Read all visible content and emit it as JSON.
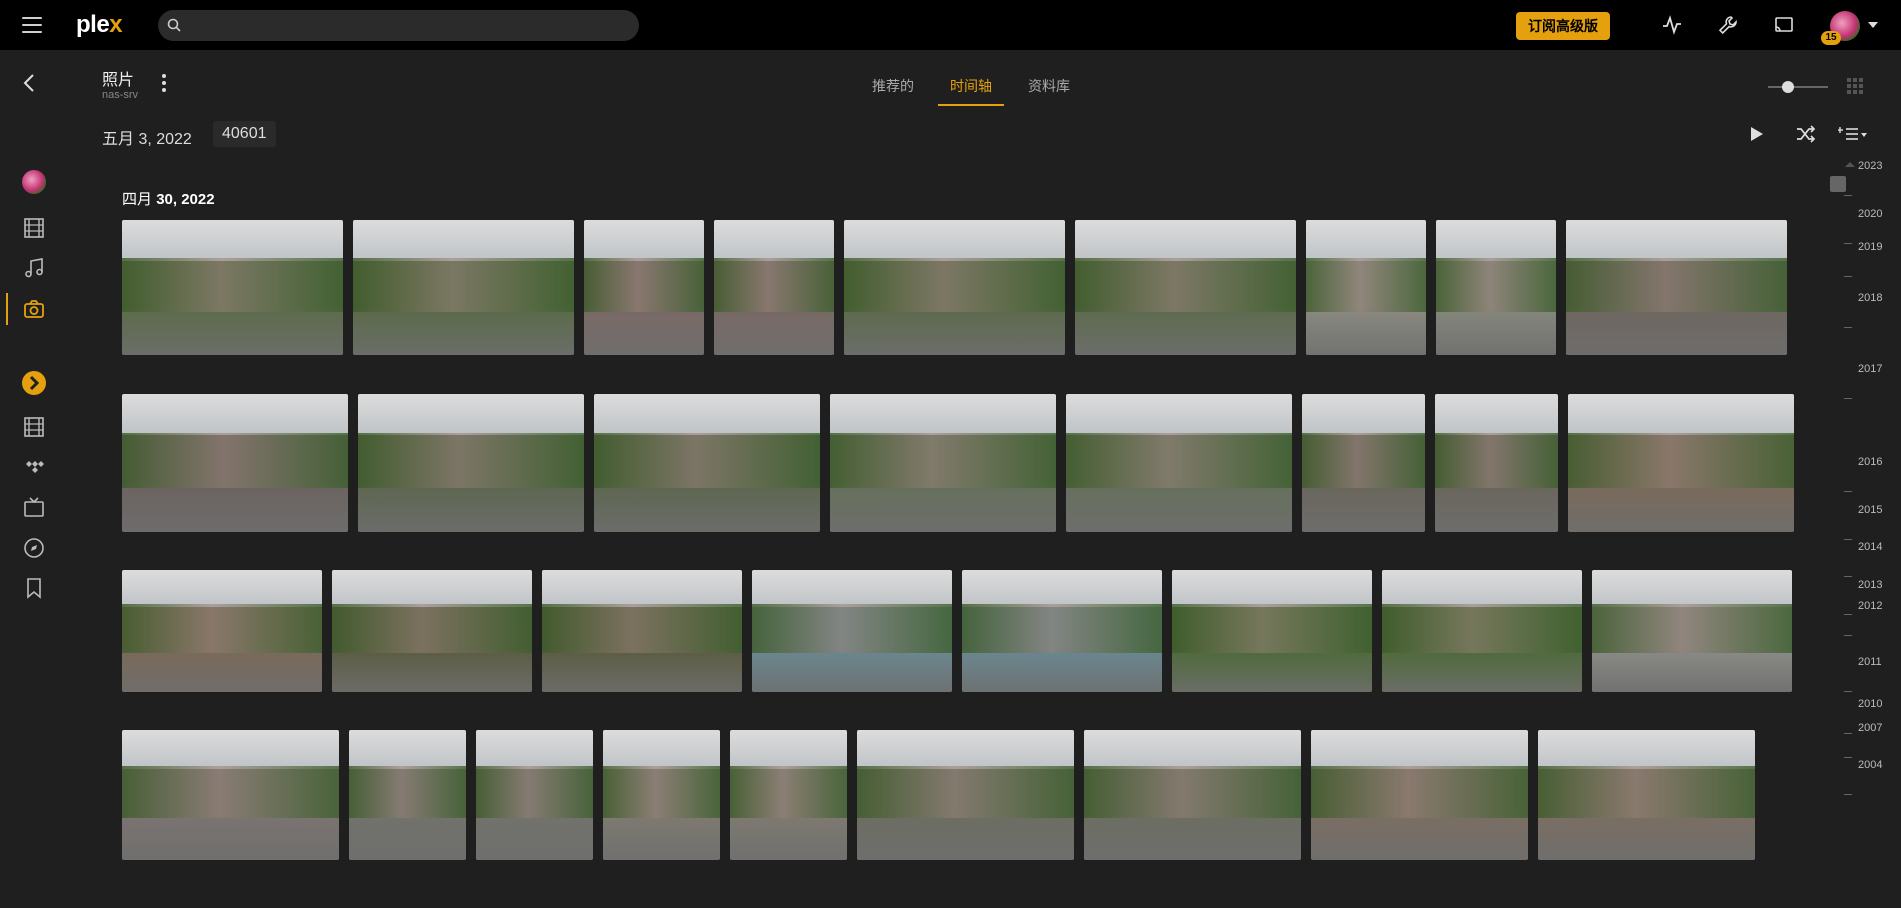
{
  "app": {
    "logo_text": "ple",
    "logo_x": "x"
  },
  "topbar": {
    "search_placeholder": "",
    "premium_label": "订阅高级版",
    "notifications_count": "15"
  },
  "library": {
    "title": "照片",
    "server": "nas-srv"
  },
  "tabs": [
    {
      "label": "推荐的",
      "active": false
    },
    {
      "label": "时间轴",
      "active": true
    },
    {
      "label": "资料库",
      "active": false
    }
  ],
  "toolbar": {
    "date": "五月 3, 2022",
    "count": "40601"
  },
  "section": {
    "month_day": "四月",
    "date": "30, 2022"
  },
  "photos": {
    "rows": [
      [
        {
          "w": 184,
          "c": "#5c6b4a"
        },
        {
          "w": 184,
          "c": "#5a6a48"
        },
        {
          "w": 100,
          "c": "#7a6a66"
        },
        {
          "w": 100,
          "c": "#786a64"
        },
        {
          "w": 184,
          "c": "#5d6a4c"
        },
        {
          "w": 184,
          "c": "#5e6b4e"
        },
        {
          "w": 100,
          "c": "#8a8a80"
        },
        {
          "w": 100,
          "c": "#85877c"
        },
        {
          "w": 184,
          "c": "#6e6660"
        }
      ],
      [
        {
          "w": 188,
          "c": "#6b6360"
        },
        {
          "w": 188,
          "c": "#5d6650"
        },
        {
          "w": 188,
          "c": "#5d6650"
        },
        {
          "w": 188,
          "c": "#66705c"
        },
        {
          "w": 188,
          "c": "#66705c"
        },
        {
          "w": 102,
          "c": "#6a665c"
        },
        {
          "w": 102,
          "c": "#6a665c"
        },
        {
          "w": 188,
          "c": "#7a6a5a"
        }
      ],
      [
        {
          "w": 166,
          "c": "#7a6a58"
        },
        {
          "w": 166,
          "c": "#5c5c42"
        },
        {
          "w": 166,
          "c": "#5c5c42"
        },
        {
          "w": 166,
          "c": "#6a8890"
        },
        {
          "w": 166,
          "c": "#6a8890"
        },
        {
          "w": 166,
          "c": "#4f6a3a"
        },
        {
          "w": 166,
          "c": "#4f6a3a"
        },
        {
          "w": 166,
          "c": "#8a8a86"
        }
      ],
      [
        {
          "w": 178,
          "c": "#7a7470"
        },
        {
          "w": 96,
          "c": "#72726c"
        },
        {
          "w": 96,
          "c": "#72726c"
        },
        {
          "w": 96,
          "c": "#7e7a70"
        },
        {
          "w": 96,
          "c": "#7e7a70"
        },
        {
          "w": 178,
          "c": "#6c6e62"
        },
        {
          "w": 178,
          "c": "#6c6e62"
        },
        {
          "w": 178,
          "c": "#7a6e62"
        },
        {
          "w": 178,
          "c": "#7a6e62"
        }
      ]
    ],
    "row_heights": [
      135,
      138,
      122,
      130
    ]
  },
  "timeline_years": [
    {
      "label": "2023",
      "t": 0.0
    },
    {
      "label": "2020",
      "t": 0.065
    },
    {
      "label": "2019",
      "t": 0.109
    },
    {
      "label": "2018",
      "t": 0.178
    },
    {
      "label": "2017",
      "t": 0.274
    },
    {
      "label": "2016",
      "t": 0.4
    },
    {
      "label": "2015",
      "t": 0.465
    },
    {
      "label": "2014",
      "t": 0.515
    },
    {
      "label": "2013",
      "t": 0.566
    },
    {
      "label": "2012",
      "t": 0.595
    },
    {
      "label": "2011",
      "t": 0.67
    },
    {
      "label": "2010",
      "t": 0.727
    },
    {
      "label": "2007",
      "t": 0.759
    },
    {
      "label": "2004",
      "t": 0.81
    }
  ],
  "icons": {
    "activity": "activity-icon",
    "settings": "wrench-icon",
    "cast": "cast-icon"
  }
}
